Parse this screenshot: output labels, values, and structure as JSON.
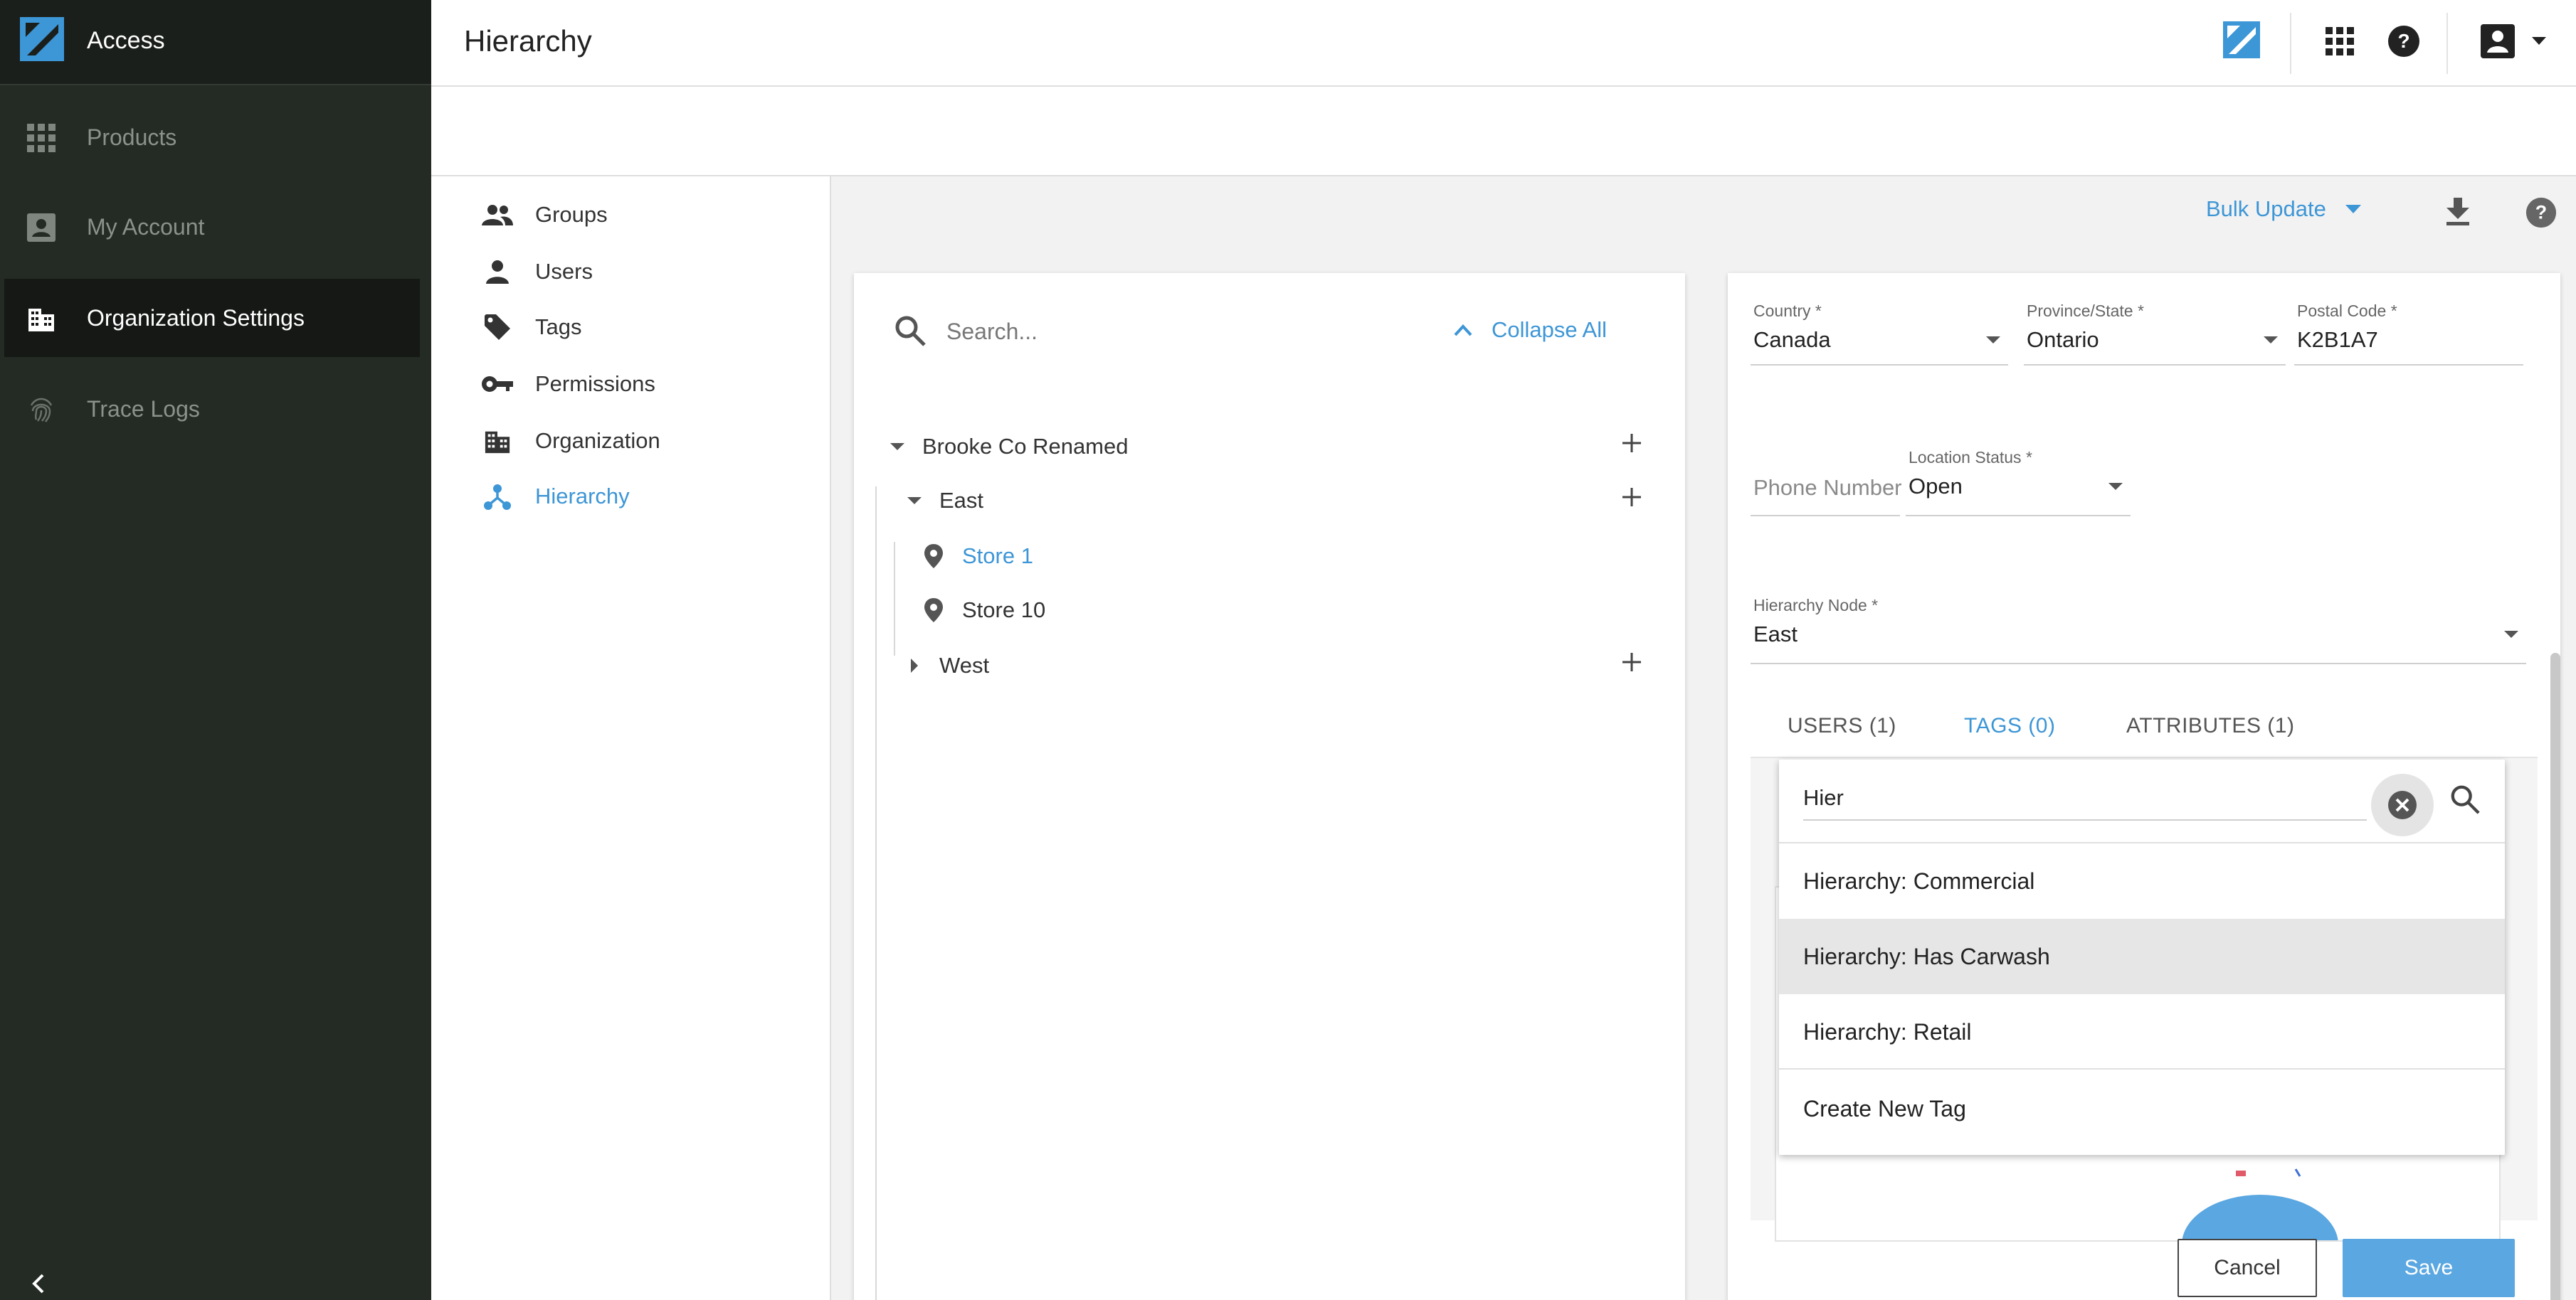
{
  "app": {
    "name": "Access"
  },
  "sidebar": {
    "items": [
      {
        "label": "Products",
        "icon": "grid-icon"
      },
      {
        "label": "My Account",
        "icon": "account-box-icon"
      },
      {
        "label": "Organization Settings",
        "icon": "building-icon",
        "active": true
      },
      {
        "label": "Trace Logs",
        "icon": "fingerprint-icon"
      }
    ]
  },
  "header": {
    "title": "Hierarchy"
  },
  "settings_nav": {
    "items": [
      {
        "label": "Groups",
        "icon": "groups-icon"
      },
      {
        "label": "Users",
        "icon": "person-icon"
      },
      {
        "label": "Tags",
        "icon": "tag-icon"
      },
      {
        "label": "Permissions",
        "icon": "key-icon"
      },
      {
        "label": "Organization",
        "icon": "building-icon"
      },
      {
        "label": "Hierarchy",
        "icon": "hierarchy-icon",
        "active": true
      }
    ]
  },
  "toolbar": {
    "bulk_update_label": "Bulk Update"
  },
  "tree": {
    "search_placeholder": "Search...",
    "collapse_all_label": "Collapse All",
    "nodes": [
      {
        "label": "Brooke Co Renamed",
        "expanded": true
      },
      {
        "label": "East",
        "expanded": true
      },
      {
        "label": "Store 1",
        "selected": true
      },
      {
        "label": "Store 10"
      },
      {
        "label": "West",
        "expanded": false
      }
    ]
  },
  "details": {
    "country": {
      "label": "Country *",
      "value": "Canada"
    },
    "province": {
      "label": "Province/State *",
      "value": "Ontario"
    },
    "postal": {
      "label": "Postal Code *",
      "value": "K2B1A7"
    },
    "phone": {
      "placeholder": "Phone Number"
    },
    "location_status": {
      "label": "Location Status *",
      "value": "Open"
    },
    "hierarchy_node": {
      "label": "Hierarchy Node *",
      "value": "East"
    },
    "tabs": [
      {
        "label": "USERS (1)"
      },
      {
        "label": "TAGS (0)",
        "active": true
      },
      {
        "label": "ATTRIBUTES (1)"
      }
    ],
    "cancel_label": "Cancel",
    "save_label": "Save"
  },
  "tag_dropdown": {
    "search_value": "Hier",
    "options": [
      {
        "label": "Hierarchy: Commercial"
      },
      {
        "label": "Hierarchy: Has Carwash",
        "highlighted": true
      },
      {
        "label": "Hierarchy: Retail"
      }
    ],
    "create_label": "Create New Tag"
  },
  "colors": {
    "accent": "#3d96d6",
    "sidebar_bg": "#242a24",
    "sidebar_active": "#151815",
    "save_button": "#5aa7e1"
  }
}
